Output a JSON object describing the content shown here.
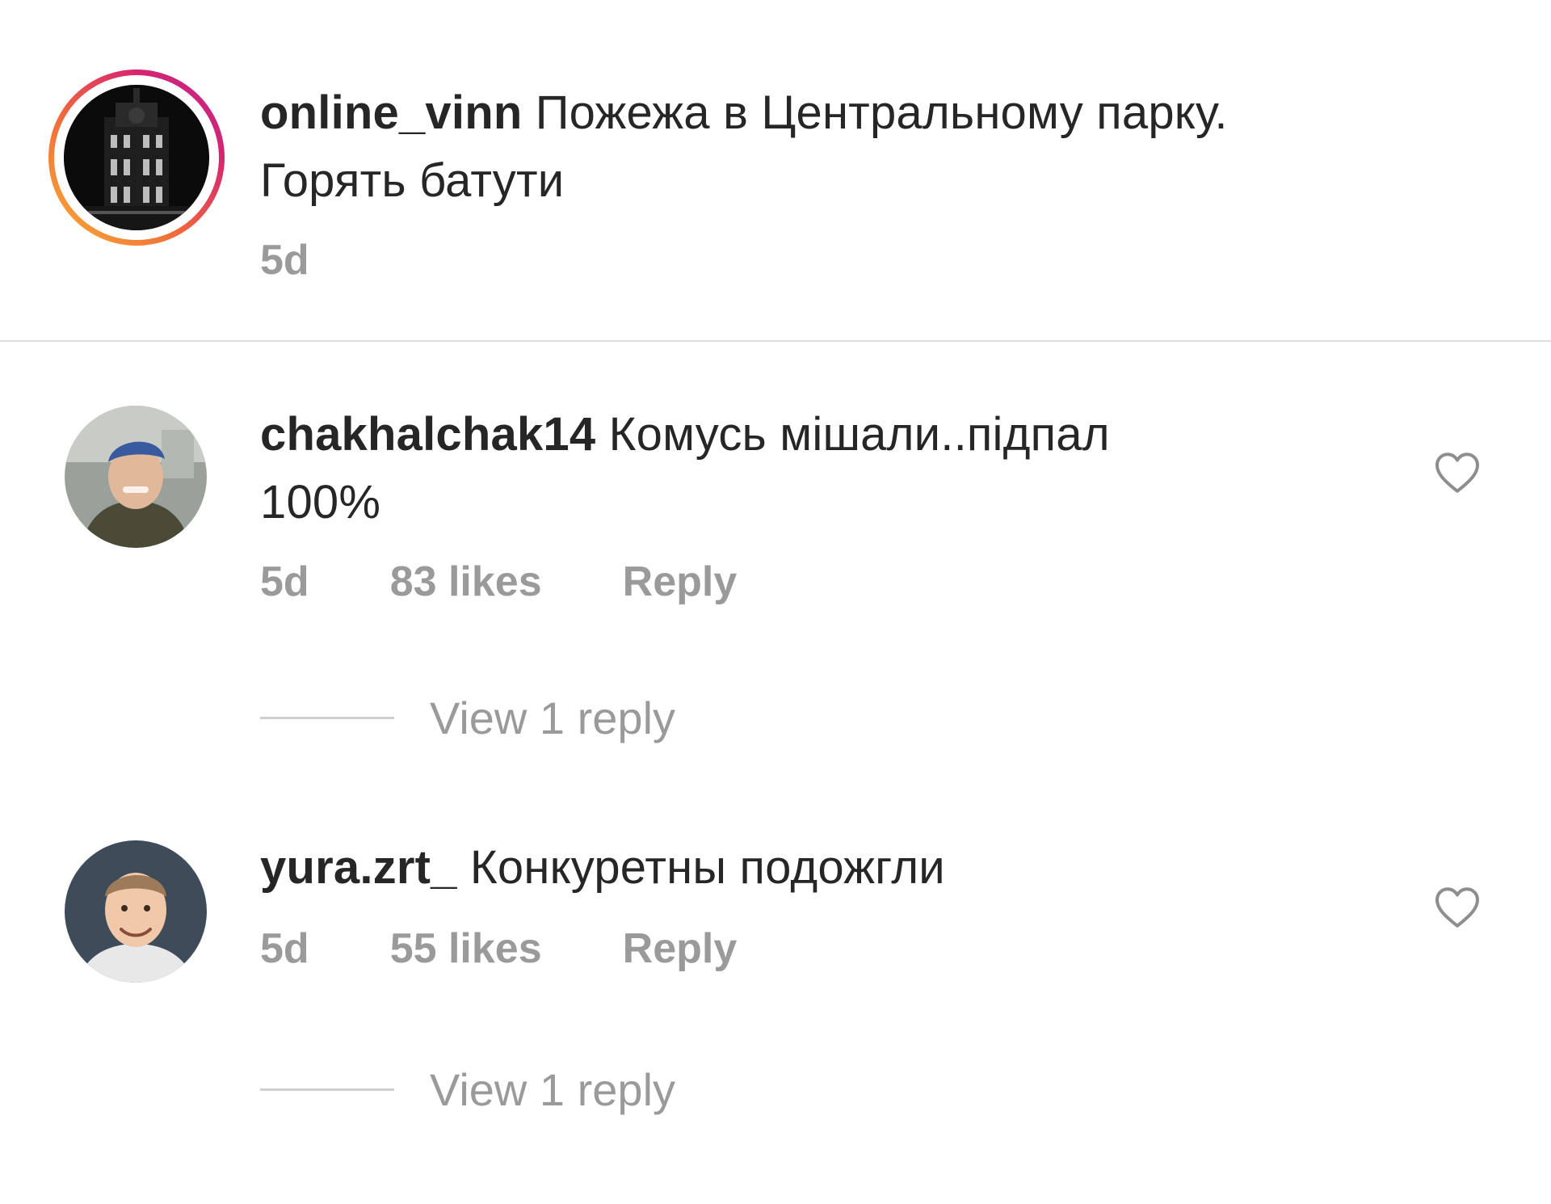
{
  "caption": {
    "username": "online_vinn",
    "text_line1": "Пожежа в Центральному парку.",
    "text_line2": "Горять батути",
    "time": "5d"
  },
  "comments": [
    {
      "username": "chakhalchak14",
      "text_line1": "Комусь мішали..підпал",
      "text_line2": "100%",
      "time": "5d",
      "likes": "83 likes",
      "reply_label": "Reply",
      "view_replies": "View 1 reply"
    },
    {
      "username": "yura.zrt_",
      "text_line1": "Конкуретны подожгли",
      "time": "5d",
      "likes": "55 likes",
      "reply_label": "Reply",
      "view_replies": "View 1 reply"
    }
  ],
  "colors": {
    "text": "#262626",
    "secondary": "#9a9a9a",
    "divider": "#dedede",
    "story_ring_start": "#f9b233",
    "story_ring_end": "#b62b95"
  },
  "icons": {
    "like": "heart-outline-icon"
  }
}
